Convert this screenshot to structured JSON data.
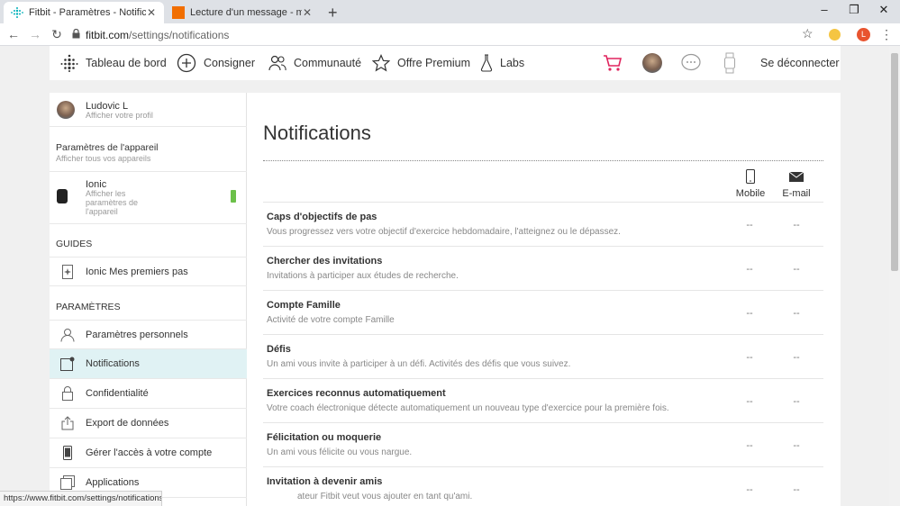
{
  "browser": {
    "tabs": [
      {
        "title": "Fitbit - Paramètres - Notifications",
        "active": true
      },
      {
        "title": "Lecture d'un message - mail Ora",
        "active": false
      }
    ],
    "new_tab": "+",
    "window_controls": {
      "minimize": "–",
      "maximize": "❐",
      "close": "✕"
    },
    "url_host": "fitbit.com",
    "url_path": "/settings/notifications",
    "profile_letter": "L",
    "status_url": "https://www.fitbit.com/settings/notifications"
  },
  "topnav": {
    "items": [
      {
        "label": "Tableau de bord",
        "icon": "dots-grid-icon"
      },
      {
        "label": "Consigner",
        "icon": "plus-circle-icon"
      },
      {
        "label": "Communauté",
        "icon": "people-icon"
      },
      {
        "label": "Offre Premium",
        "icon": "star-icon"
      },
      {
        "label": "Labs",
        "icon": "flask-icon"
      }
    ],
    "logout": "Se déconnecter"
  },
  "sidebar": {
    "profile": {
      "name": "Ludovic L",
      "sub": "Afficher votre profil"
    },
    "device_header": {
      "title": "Paramètres de l'appareil",
      "sub": "Afficher tous vos appareils"
    },
    "device": {
      "name": "Ionic",
      "sub": "Afficher les paramètres de l'appareil"
    },
    "guides_title": "GUIDES",
    "guides": [
      {
        "label": "Ionic Mes premiers pas"
      }
    ],
    "settings_title": "PARAMÈTRES",
    "settings": [
      {
        "label": "Paramètres personnels"
      },
      {
        "label": "Notifications"
      },
      {
        "label": "Confidentialité"
      },
      {
        "label": "Export de données"
      },
      {
        "label": "Gérer l'accès à votre compte"
      },
      {
        "label": "Applications"
      }
    ]
  },
  "main": {
    "title": "Notifications",
    "col_mobile": "Mobile",
    "col_email": "E-mail",
    "rows": [
      {
        "title": "Caps d'objectifs de pas",
        "desc": "Vous progressez vers votre objectif d'exercice hebdomadaire, l'atteignez ou le dépassez.",
        "mobile": "--",
        "email": "--"
      },
      {
        "title": "Chercher des invitations",
        "desc": "Invitations à participer aux études de recherche.",
        "mobile": "--",
        "email": "--"
      },
      {
        "title": "Compte Famille",
        "desc": "Activité de votre compte Famille",
        "mobile": "--",
        "email": "--"
      },
      {
        "title": "Défis",
        "desc": "Un ami vous invite à participer à un défi. Activités des défis que vous suivez.",
        "mobile": "--",
        "email": "--"
      },
      {
        "title": "Exercices reconnus automatiquement",
        "desc": "Votre coach électronique détecte automatiquement un nouveau type d'exercice pour la première fois.",
        "mobile": "--",
        "email": "--"
      },
      {
        "title": "Félicitation ou moquerie",
        "desc": "Un ami vous félicite ou vous nargue.",
        "mobile": "--",
        "email": "--"
      },
      {
        "title": "Invitation à devenir amis",
        "desc": "ateur Fitbit veut vous ajouter en tant qu'ami.",
        "mobile": "--",
        "email": "--"
      }
    ]
  },
  "colors": {
    "accent": "#00b0b9",
    "active_bg": "#e0f2f4",
    "cart": "#e0245e",
    "battery": "#6cc04a"
  }
}
